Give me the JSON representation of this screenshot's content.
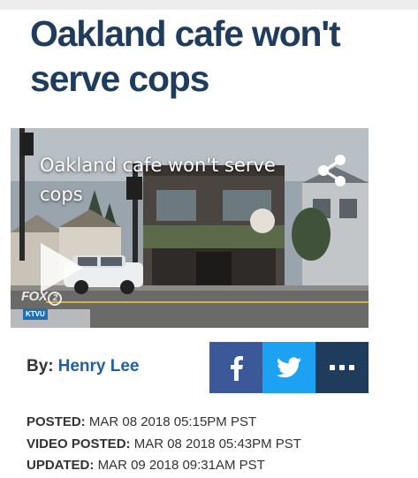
{
  "article": {
    "headline": "Oakland cafe won't serve cops"
  },
  "video": {
    "title": "Oakland cafe won't serve cops",
    "network_logo": "FOX",
    "channel_number": "2",
    "station_badge": "KTVU",
    "share_icon": "share-icon",
    "play_icon": "play-icon"
  },
  "byline": {
    "prefix": "By:",
    "author": "Henry Lee"
  },
  "social": {
    "facebook_icon": "facebook-icon",
    "twitter_icon": "twitter-icon",
    "more_icon": "more-icon",
    "colors": {
      "facebook": "#3b5998",
      "twitter": "#1da1f2",
      "more": "#1f3c5d"
    }
  },
  "meta": {
    "posted_label": "POSTED:",
    "posted_value": "MAR 08 2018 05:15PM PST",
    "video_posted_label": "VIDEO POSTED:",
    "video_posted_value": "MAR 08 2018 05:43PM PST",
    "updated_label": "UPDATED:",
    "updated_value": "MAR 09 2018 09:31AM PST"
  },
  "colors": {
    "headline": "#1f3c5d",
    "author_link": "#1f5fa8"
  }
}
